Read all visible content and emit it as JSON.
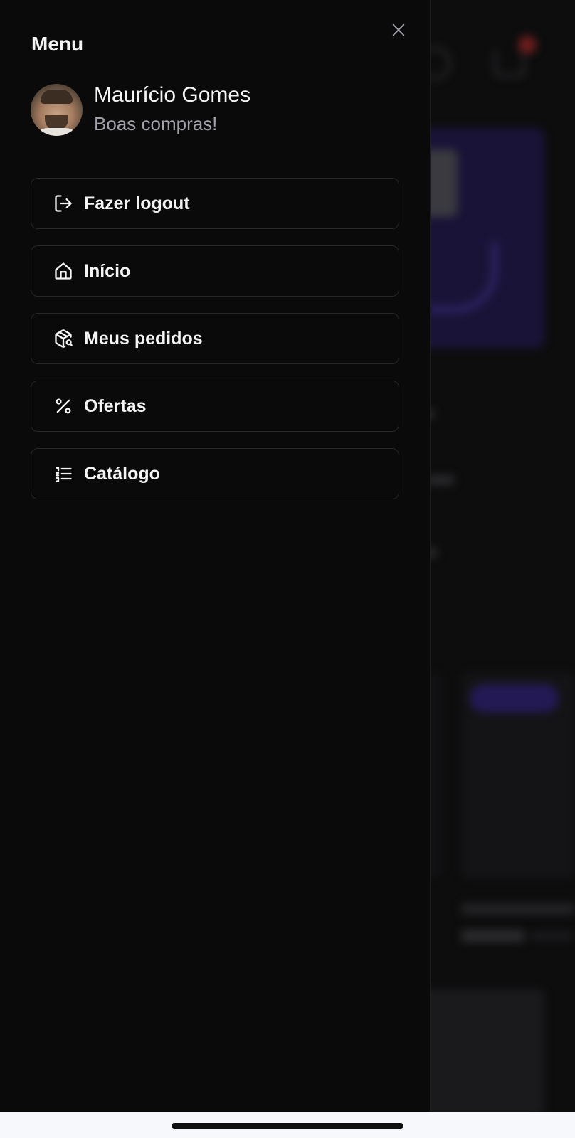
{
  "drawer": {
    "title": "Menu",
    "close_icon": "close-icon"
  },
  "profile": {
    "name": "Maurício Gomes",
    "subtitle": "Boas compras!"
  },
  "nav": {
    "items": [
      {
        "label": "Fazer logout",
        "icon": "logout-icon"
      },
      {
        "label": "Início",
        "icon": "home-icon"
      },
      {
        "label": "Meus pedidos",
        "icon": "package-search-icon"
      },
      {
        "label": "Ofertas",
        "icon": "percent-icon"
      },
      {
        "label": "Catálogo",
        "icon": "list-ordered-icon"
      }
    ]
  },
  "colors": {
    "drawer_bg": "#0a0a0b",
    "text": "#f4f4f5",
    "muted_text": "#a1a1aa",
    "border": "#27272a"
  }
}
